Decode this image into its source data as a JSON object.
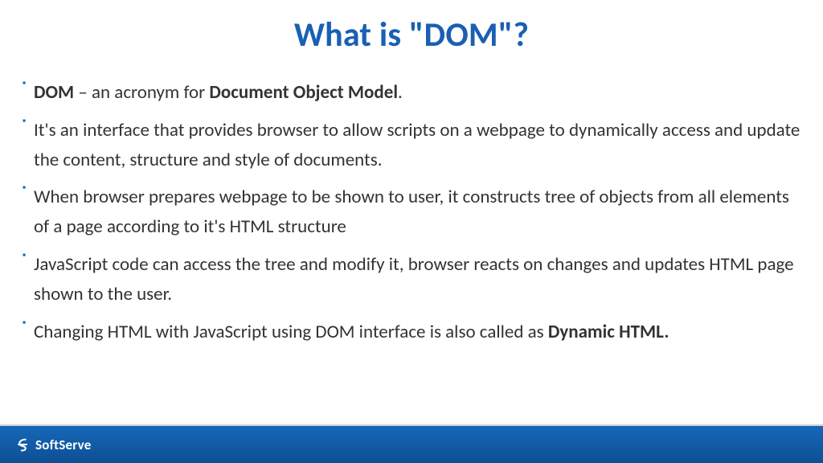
{
  "title": "What is \"DOM\"?",
  "bullets": [
    {
      "segments": [
        {
          "t": "DOM",
          "b": true
        },
        {
          "t": " – an acronym for ",
          "b": false
        },
        {
          "t": "Document Object Model",
          "b": true
        },
        {
          "t": ".",
          "b": false
        }
      ]
    },
    {
      "segments": [
        {
          "t": "It's an interface that provides browser to allow scripts on a webpage to dynamically access and update the content, structure and style of documents.",
          "b": false
        }
      ]
    },
    {
      "segments": [
        {
          "t": "When browser prepares webpage to be shown to user, it constructs tree of objects from all elements of a page according to it's HTML structure",
          "b": false
        }
      ]
    },
    {
      "segments": [
        {
          "t": "JavaScript code can access the tree and modify it, browser reacts on changes and updates HTML page shown to the user.",
          "b": false
        }
      ]
    },
    {
      "segments": [
        {
          "t": "Changing HTML with JavaScript using DOM interface is also called as ",
          "b": false
        },
        {
          "t": "Dynamic HTML.",
          "b": true
        }
      ]
    }
  ],
  "footer": {
    "brand": "SoftServe"
  },
  "colors": {
    "accent": "#1a5fb4",
    "footer_start": "#1668b8",
    "footer_end": "#0e4f93"
  }
}
